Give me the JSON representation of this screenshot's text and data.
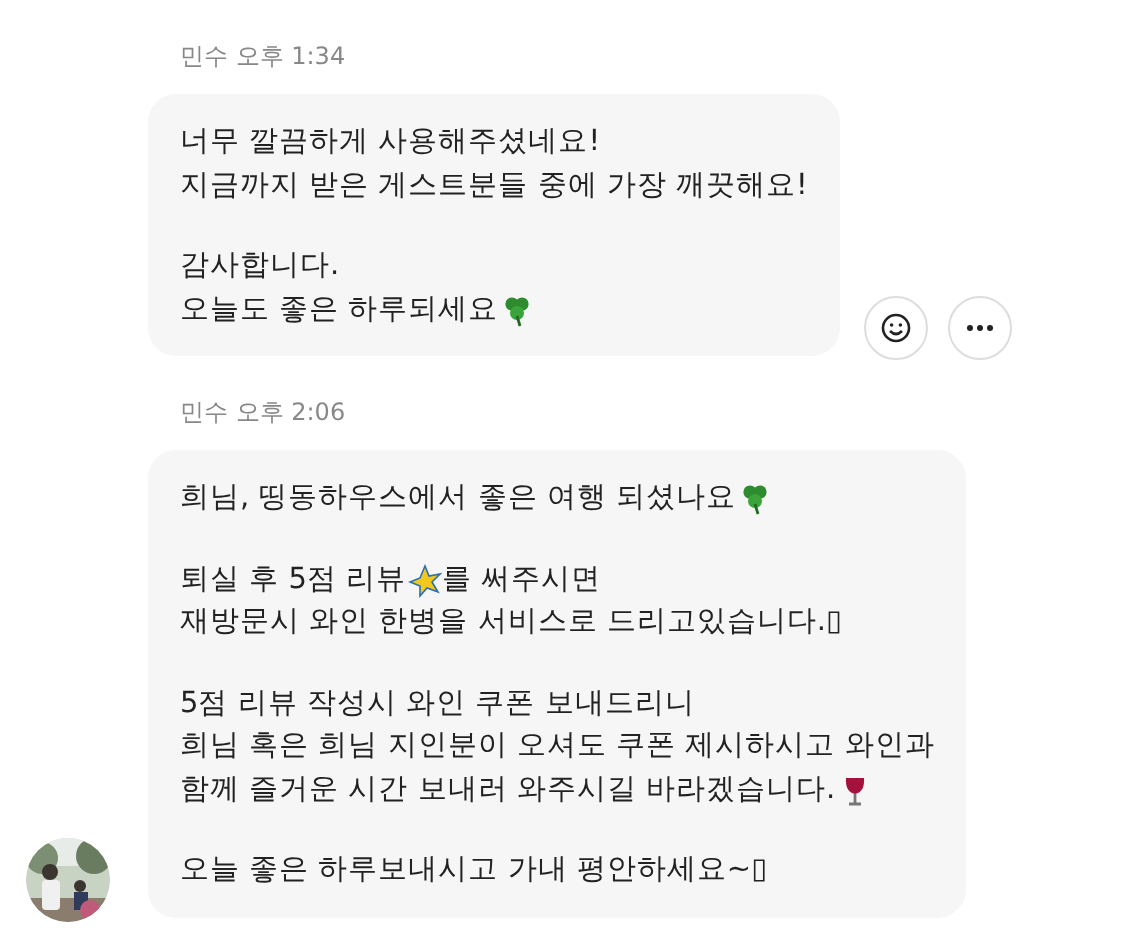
{
  "messages": [
    {
      "meta": "민수 오후 1:34",
      "avatar": false,
      "actions": true,
      "lines": [
        {
          "kind": "text",
          "parts": [
            {
              "kind": "text",
              "text": "너무 깔끔하게 사용해주셨네요!"
            }
          ]
        },
        {
          "kind": "text",
          "parts": [
            {
              "kind": "text",
              "text": "지금까지 받은 게스트분들 중에 가장 깨끗해요!"
            }
          ]
        },
        {
          "kind": "blank"
        },
        {
          "kind": "text",
          "parts": [
            {
              "kind": "text",
              "text": "감사합니다."
            }
          ]
        },
        {
          "kind": "text",
          "parts": [
            {
              "kind": "text",
              "text": "오늘도 좋은 하루되세요"
            },
            {
              "kind": "clover"
            }
          ]
        }
      ]
    },
    {
      "meta": "민수 오후 2:06",
      "avatar": true,
      "actions": false,
      "lines": [
        {
          "kind": "text",
          "parts": [
            {
              "kind": "text",
              "text": "희님, 띵동하우스에서 좋은 여행 되셨나요"
            },
            {
              "kind": "clover"
            }
          ]
        },
        {
          "kind": "blank"
        },
        {
          "kind": "text",
          "parts": [
            {
              "kind": "text",
              "text": "퇴실 후 5점 리뷰"
            },
            {
              "kind": "sparkle"
            },
            {
              "kind": "text",
              "text": "를 써주시면"
            }
          ]
        },
        {
          "kind": "text",
          "parts": [
            {
              "kind": "text",
              "text": "재방문시 와인 한병을 서비스로 드리고있습니다.▯"
            }
          ]
        },
        {
          "kind": "blank"
        },
        {
          "kind": "text",
          "parts": [
            {
              "kind": "text",
              "text": "5점 리뷰 작성시 와인 쿠폰 보내드리니"
            }
          ]
        },
        {
          "kind": "text",
          "parts": [
            {
              "kind": "text",
              "text": "희님 혹은 희님 지인분이 오셔도 쿠폰 제시하시고 와인과"
            }
          ]
        },
        {
          "kind": "text",
          "parts": [
            {
              "kind": "text",
              "text": "함께 즐거운 시간 보내러 와주시길 바라겠습니다."
            },
            {
              "kind": "wine"
            }
          ]
        },
        {
          "kind": "blank"
        },
        {
          "kind": "text",
          "parts": [
            {
              "kind": "text",
              "text": "오늘 좋은 하루보내시고 가내 평안하세요~▯"
            }
          ]
        }
      ]
    }
  ]
}
